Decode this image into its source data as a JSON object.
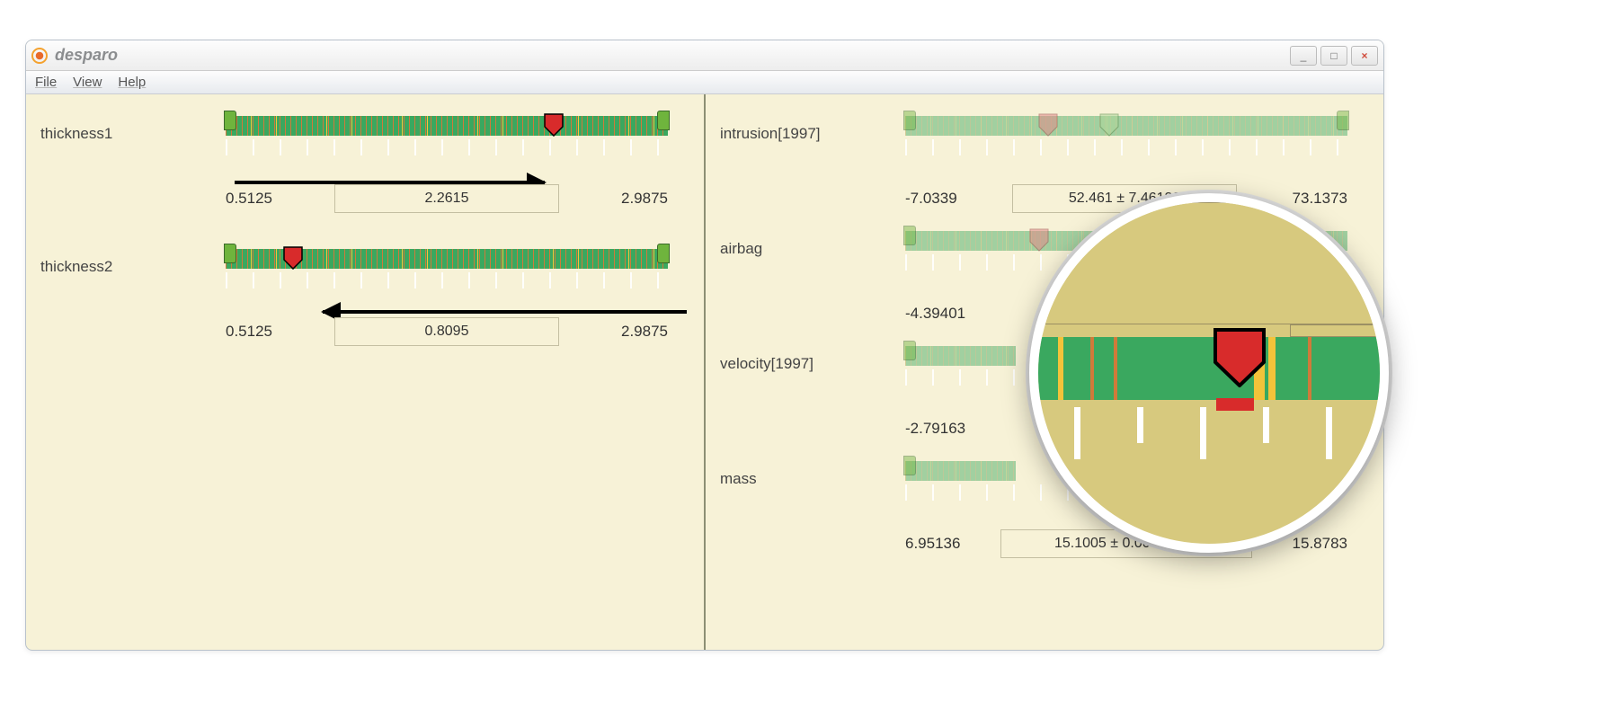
{
  "app": {
    "title": "desparo"
  },
  "menu": {
    "file": "File",
    "view": "View",
    "help": "Help"
  },
  "left": {
    "rows": [
      {
        "label": "thickness1",
        "min": "0.5125",
        "value": "2.2615",
        "max": "2.9875",
        "pointer_pct": 72,
        "faded": false
      },
      {
        "label": "thickness2",
        "min": "0.5125",
        "value": "0.8095",
        "max": "2.9875",
        "pointer_pct": 13,
        "faded": false
      }
    ]
  },
  "right": {
    "rows": [
      {
        "label": "intrusion[1997]",
        "min": "-7.0339",
        "value": "52.461 ± 7.46138",
        "max": "73.1373",
        "pointer_pct": 30,
        "faded": true
      },
      {
        "label": "airbag",
        "min": "-4.39401",
        "value": "",
        "max": "",
        "pointer_pct": 28,
        "faded": true
      },
      {
        "label": "velocity[1997]",
        "min": "-2.79163",
        "value": "",
        "max": "",
        "pointer_pct": null,
        "faded": true
      },
      {
        "label": "mass",
        "min": "6.95136",
        "value": "15.1005 ± 0.00924471",
        "max": "15.8783",
        "pointer_pct": null,
        "faded": true
      }
    ]
  },
  "window_controls": {
    "min": "_",
    "max": "□",
    "close": "×"
  }
}
